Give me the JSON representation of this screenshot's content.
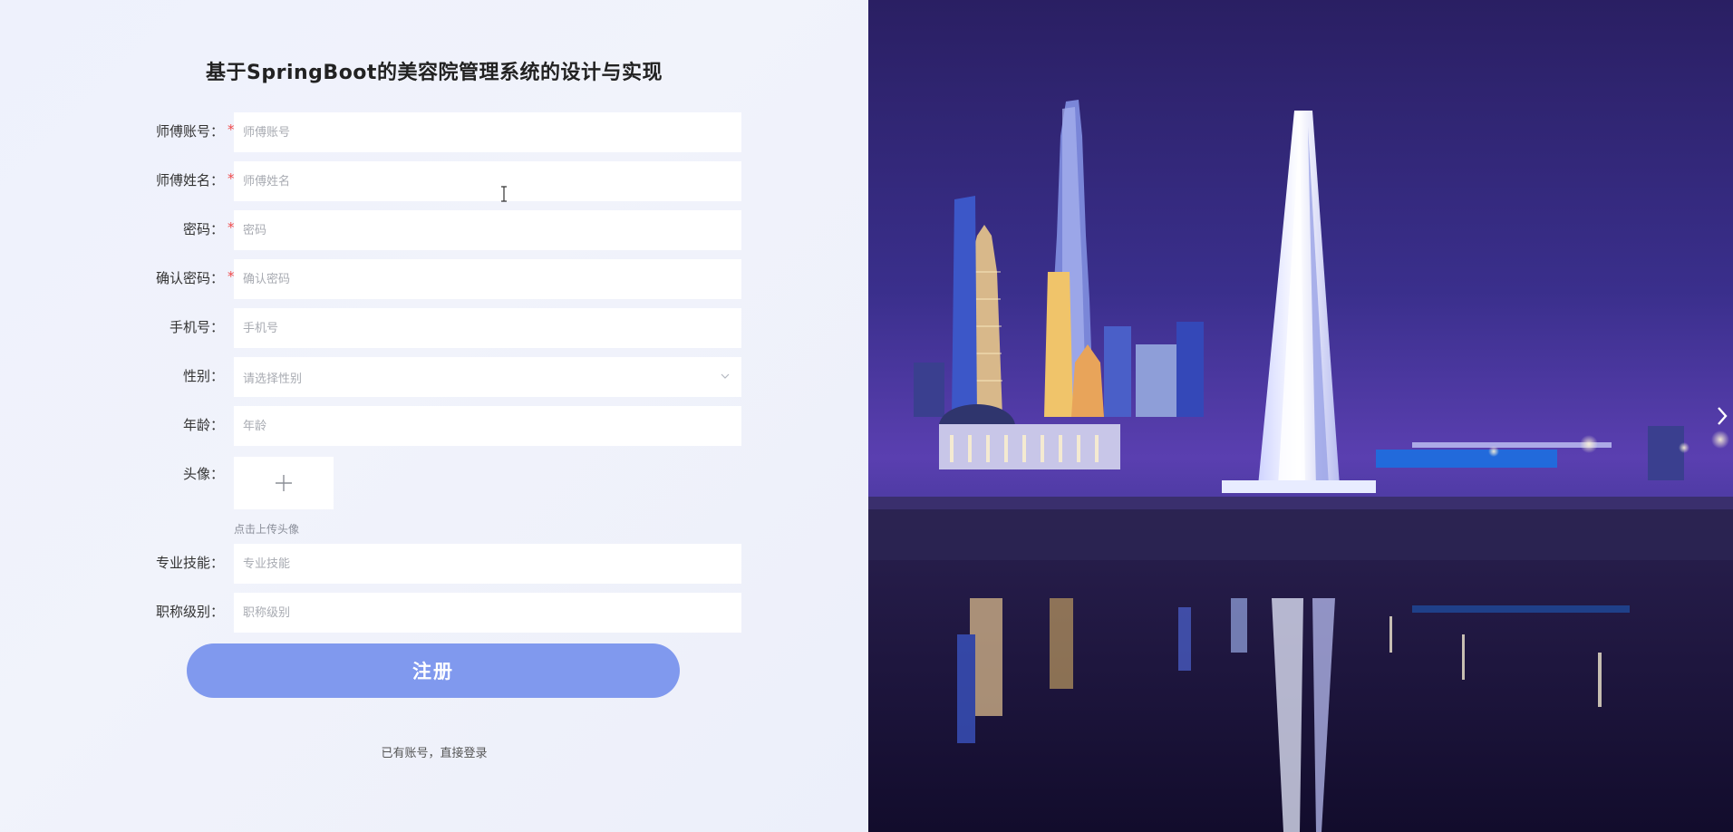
{
  "page": {
    "title": "基于SpringBoot的美容院管理系统的设计与实现"
  },
  "form": {
    "required_mark": "*",
    "fields": [
      {
        "label": "师傅账号：",
        "placeholder": "师傅账号",
        "required": true
      },
      {
        "label": "师傅姓名：",
        "placeholder": "师傅姓名",
        "required": true
      },
      {
        "label": "密码：",
        "placeholder": "密码",
        "required": true
      },
      {
        "label": "确认密码：",
        "placeholder": "确认密码",
        "required": true
      },
      {
        "label": "手机号：",
        "placeholder": "手机号",
        "required": false
      },
      {
        "label": "性别：",
        "placeholder": "请选择性别",
        "required": false
      },
      {
        "label": "年龄：",
        "placeholder": "年龄",
        "required": false
      },
      {
        "label": "头像：",
        "placeholder": "",
        "required": false
      },
      {
        "label": "专业技能：",
        "placeholder": "专业技能",
        "required": false
      },
      {
        "label": "职称级别：",
        "placeholder": "职称级别",
        "required": false
      }
    ],
    "avatar_hint": "点击上传头像",
    "submit_label": "注册",
    "login_link": "已有账号，直接登录"
  },
  "colors": {
    "accent_button": "#8099ee",
    "required": "#f04a4a",
    "background": "#eef1fb"
  },
  "icons": {
    "select": "chevron-down-icon",
    "upload": "plus-icon",
    "carousel": "chevron-right-icon"
  }
}
